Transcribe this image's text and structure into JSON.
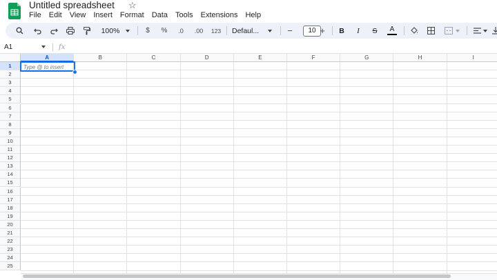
{
  "app": {
    "title": "Untitled spreadsheet",
    "brand_color": "#0f9d58"
  },
  "menu": [
    "File",
    "Edit",
    "View",
    "Insert",
    "Format",
    "Data",
    "Tools",
    "Extensions",
    "Help"
  ],
  "toolbar": {
    "zoom": "100%",
    "currency": "$",
    "percent": "%",
    "decrease_decimal": ".0",
    "increase_decimal": ".00",
    "more_formats": "123",
    "font": "Defaul...",
    "font_size": "10",
    "minus": "−",
    "plus": "+",
    "bold": "B",
    "italic": "I",
    "strike": "S",
    "text_color_label": "A",
    "text_color": "#000000"
  },
  "formula_bar": {
    "name_box": "A1",
    "fx": "fx"
  },
  "grid": {
    "columns": [
      "A",
      "B",
      "C",
      "D",
      "E",
      "F",
      "G",
      "H",
      "I"
    ],
    "rows": [
      "1",
      "2",
      "3",
      "4",
      "5",
      "6",
      "7",
      "8",
      "9",
      "10",
      "11",
      "12",
      "13",
      "14",
      "15",
      "16",
      "17",
      "18",
      "19",
      "20",
      "21",
      "22",
      "23",
      "24",
      "25"
    ],
    "selected_cell": "A1",
    "active_cell_hint": "Type @ to insert"
  }
}
